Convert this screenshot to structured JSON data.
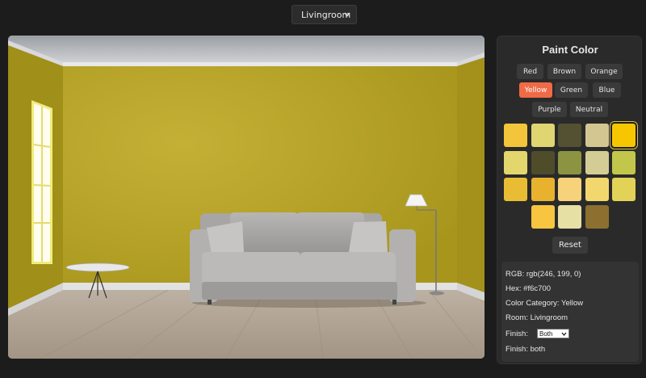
{
  "room_select": {
    "value": "Livingroom"
  },
  "panel": {
    "title": "Paint Color",
    "accent": "#f06a47",
    "categories": [
      {
        "label": "Red",
        "active": false
      },
      {
        "label": "Brown",
        "active": false
      },
      {
        "label": "Orange",
        "active": false
      },
      {
        "label": "Yellow",
        "active": true
      },
      {
        "label": "Green",
        "active": false
      },
      {
        "label": "Blue",
        "active": false
      },
      {
        "label": "Purple",
        "active": false
      },
      {
        "label": "Neutral",
        "active": false
      }
    ],
    "swatches": [
      {
        "color": "#f2c53a"
      },
      {
        "color": "#dfd571"
      },
      {
        "color": "#545133"
      },
      {
        "color": "#d4c690"
      },
      {
        "color": "#f6c700",
        "selected": true
      },
      {
        "color": "#e3d66d"
      },
      {
        "color": "#4f4c2a"
      },
      {
        "color": "#8c9442"
      },
      {
        "color": "#d3cd95"
      },
      {
        "color": "#c2c74b"
      },
      {
        "color": "#e8bd33"
      },
      {
        "color": "#e8b22e"
      },
      {
        "color": "#f6d27a"
      },
      {
        "color": "#f2d66e"
      },
      {
        "color": "#e2d257"
      },
      {
        "color": "#f7c540"
      },
      {
        "color": "#e6e0a5"
      },
      {
        "color": "#8c7030"
      }
    ],
    "reset_label": "Reset"
  },
  "info": {
    "rgb": "RGB: rgb(246, 199, 0)",
    "hex": "Hex: #f6c700",
    "category": "Color Category: Yellow",
    "room": "Room: Livingroom",
    "finish_label": "Finish:",
    "finish_value": "Both",
    "finish_text": "Finish: both"
  },
  "colors": {
    "wall": "#b2a021",
    "background": "#1c1c1c"
  }
}
